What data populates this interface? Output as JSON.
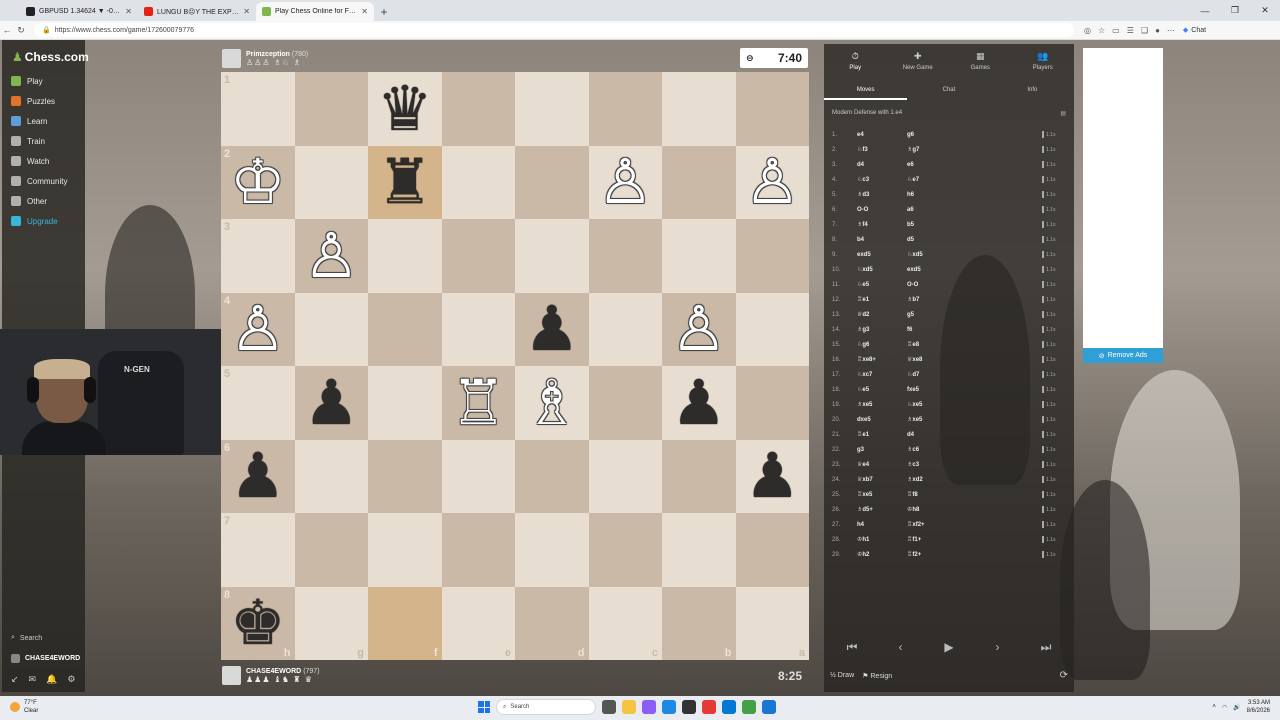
{
  "browser": {
    "tabs": [
      {
        "title": "GBPUSD 1.34624 ▼ -0.04% $100",
        "fav": "#222222",
        "active": false
      },
      {
        "title": "LUNGU B☹Y THE EXPERIENC",
        "fav": "#e62117",
        "active": false
      },
      {
        "title": "Play Chess Online for FREE ...",
        "fav": "#81b64c",
        "active": true
      }
    ],
    "url": "https://www.chess.com/game/172600079776",
    "chat_label": "Chat"
  },
  "sidebar": {
    "logo": "Chess.com",
    "items": [
      {
        "label": "Play",
        "color": "#81b64c"
      },
      {
        "label": "Puzzles",
        "color": "#e2732a"
      },
      {
        "label": "Learn",
        "color": "#5d9edb"
      },
      {
        "label": "Train",
        "color": "#b0b0b0"
      },
      {
        "label": "Watch",
        "color": "#b0b0b0"
      },
      {
        "label": "Community",
        "color": "#b0b0b0"
      },
      {
        "label": "Other",
        "color": "#b0b0b0"
      },
      {
        "label": "Upgrade",
        "color": "#38b6d8"
      }
    ],
    "search_placeholder": "Search",
    "username": "CHASE4EWORD"
  },
  "webcam": {
    "chair_brand": "N-GEN"
  },
  "top_player": {
    "name": "Primzception",
    "rating": "(780)",
    "captures": "♙♙♙ ♗♘ ♗",
    "clock": "7:40"
  },
  "bottom_player": {
    "name": "CHASE4EWORD",
    "rating": "(797)",
    "captures": "♟♟♟ ♝♞ ♜ ♛",
    "clock": "8:25"
  },
  "board": {
    "ranks": [
      "1",
      "2",
      "3",
      "4",
      "5",
      "6",
      "7",
      "8"
    ],
    "files": [
      "h",
      "g",
      "f",
      "e",
      "d",
      "c",
      "b",
      "a"
    ],
    "pieces": [
      {
        "sq": "f1",
        "glyph": "♛",
        "color": "b"
      },
      {
        "sq": "h2",
        "glyph": "♔",
        "color": "w"
      },
      {
        "sq": "f2",
        "glyph": "♜",
        "color": "b"
      },
      {
        "sq": "c2",
        "glyph": "♙",
        "color": "w"
      },
      {
        "sq": "a2",
        "glyph": "♙",
        "color": "w"
      },
      {
        "sq": "g3",
        "glyph": "♙",
        "color": "w"
      },
      {
        "sq": "h4",
        "glyph": "♙",
        "color": "w"
      },
      {
        "sq": "d4",
        "glyph": "♟",
        "color": "b"
      },
      {
        "sq": "b4",
        "glyph": "♙",
        "color": "w"
      },
      {
        "sq": "g5",
        "glyph": "♟",
        "color": "b"
      },
      {
        "sq": "e5",
        "glyph": "♖",
        "color": "w"
      },
      {
        "sq": "d5",
        "glyph": "♗",
        "color": "w"
      },
      {
        "sq": "b5",
        "glyph": "♟",
        "color": "b"
      },
      {
        "sq": "h6",
        "glyph": "♟",
        "color": "b"
      },
      {
        "sq": "a6",
        "glyph": "♟",
        "color": "b"
      },
      {
        "sq": "h8",
        "glyph": "♚",
        "color": "b"
      }
    ],
    "highlights": [
      "f2",
      "f8"
    ]
  },
  "right_panel": {
    "tabs": [
      {
        "label": "Play",
        "icon": "⏱",
        "active": true
      },
      {
        "label": "New Game",
        "icon": "✚",
        "active": false
      },
      {
        "label": "Games",
        "icon": "▦",
        "active": false
      },
      {
        "label": "Players",
        "icon": "👥",
        "active": false
      }
    ],
    "subtabs": [
      {
        "label": "Moves",
        "active": true
      },
      {
        "label": "Chat",
        "active": false
      },
      {
        "label": "Info",
        "active": false
      }
    ],
    "opening": "Modern Defense with 1.e4",
    "moves": [
      {
        "n": "1.",
        "w": "e4",
        "b": "g6"
      },
      {
        "n": "2.",
        "w": "♘f3",
        "b": "♗g7"
      },
      {
        "n": "3.",
        "w": "d4",
        "b": "e6"
      },
      {
        "n": "4.",
        "w": "♘c3",
        "b": "♘e7"
      },
      {
        "n": "5.",
        "w": "♗d3",
        "b": "h6"
      },
      {
        "n": "6.",
        "w": "O-O",
        "b": "a6"
      },
      {
        "n": "7.",
        "w": "♗f4",
        "b": "b5"
      },
      {
        "n": "8.",
        "w": "b4",
        "b": "d5"
      },
      {
        "n": "9.",
        "w": "exd5",
        "b": "♘xd5"
      },
      {
        "n": "10.",
        "w": "♘xd5",
        "b": "exd5"
      },
      {
        "n": "11.",
        "w": "♘e5",
        "b": "O-O"
      },
      {
        "n": "12.",
        "w": "♖e1",
        "b": "♗b7"
      },
      {
        "n": "13.",
        "w": "♕d2",
        "b": "g5"
      },
      {
        "n": "14.",
        "w": "♗g3",
        "b": "f6"
      },
      {
        "n": "15.",
        "w": "♘g6",
        "b": "♖e8"
      },
      {
        "n": "16.",
        "w": "♖xe8+",
        "b": "♕xe8"
      },
      {
        "n": "17.",
        "w": "♘xc7",
        "b": "♘d7"
      },
      {
        "n": "18.",
        "w": "♘e5",
        "b": "fxe5"
      },
      {
        "n": "19.",
        "w": "♗xe5",
        "b": "♘xe5"
      },
      {
        "n": "20.",
        "w": "dxe5",
        "b": "♗xe5"
      },
      {
        "n": "21.",
        "w": "♖e1",
        "b": "d4"
      },
      {
        "n": "22.",
        "w": "g3",
        "b": "♗c6"
      },
      {
        "n": "23.",
        "w": "♕e4",
        "b": "♗c3"
      },
      {
        "n": "24.",
        "w": "♕xb7",
        "b": "♗xd2"
      },
      {
        "n": "25.",
        "w": "♖xe5",
        "b": "♖f8"
      },
      {
        "n": "26.",
        "w": "♗d5+",
        "b": "♔h8"
      },
      {
        "n": "27.",
        "w": "h4",
        "b": "♖xf2+"
      },
      {
        "n": "28.",
        "w": "♔h1",
        "b": "♖f1+"
      },
      {
        "n": "29.",
        "w": "♔h2",
        "b": "♖f2+"
      }
    ],
    "move_time": "1.1s",
    "controls": [
      "⏮",
      "‹",
      "▶",
      "›",
      "⏭"
    ],
    "draw_label": "Draw",
    "resign_label": "Resign"
  },
  "ad": {
    "remove_label": "Remove Ads"
  },
  "taskbar": {
    "temp": "77°F",
    "cond": "Clear",
    "search_placeholder": "Search",
    "time": "3:53 AM",
    "date": "8/6/2026"
  }
}
